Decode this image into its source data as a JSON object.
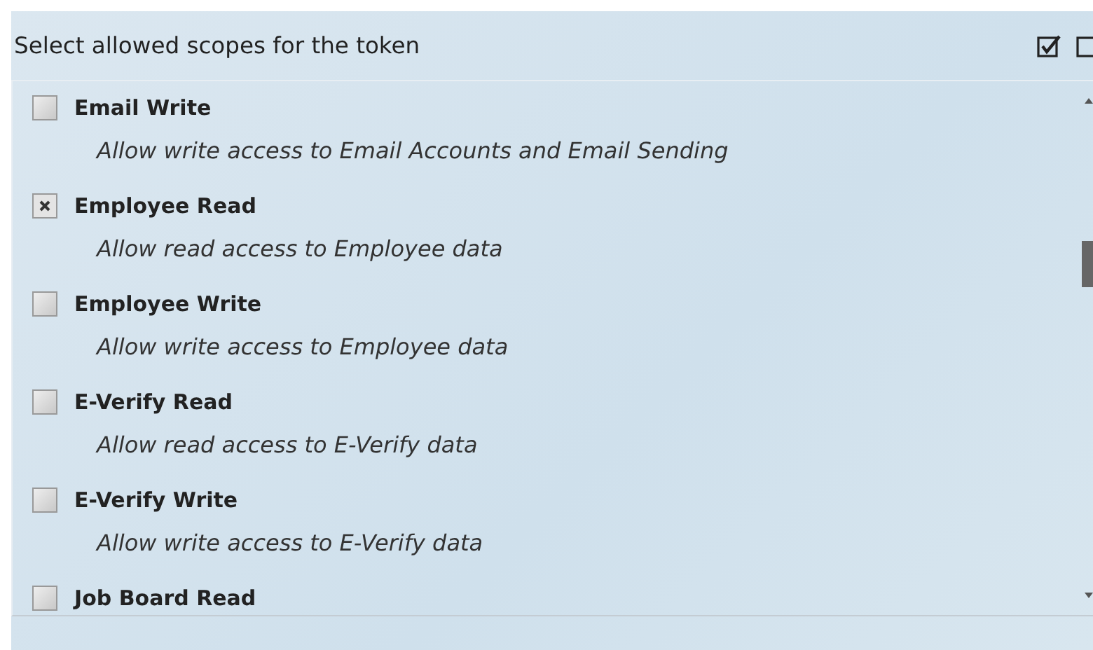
{
  "header": {
    "title": "Select allowed scopes for the token"
  },
  "scopes": [
    {
      "name": "Email Write",
      "description": "Allow write access to Email Accounts and Email Sending",
      "checked": false
    },
    {
      "name": "Employee Read",
      "description": "Allow read access to Employee data",
      "checked": true
    },
    {
      "name": "Employee Write",
      "description": "Allow write access to Employee data",
      "checked": false
    },
    {
      "name": "E-Verify Read",
      "description": "Allow read access to E-Verify data",
      "checked": false
    },
    {
      "name": "E-Verify Write",
      "description": "Allow write access to E-Verify data",
      "checked": false
    },
    {
      "name": "Job Board Read",
      "checked": false
    }
  ]
}
